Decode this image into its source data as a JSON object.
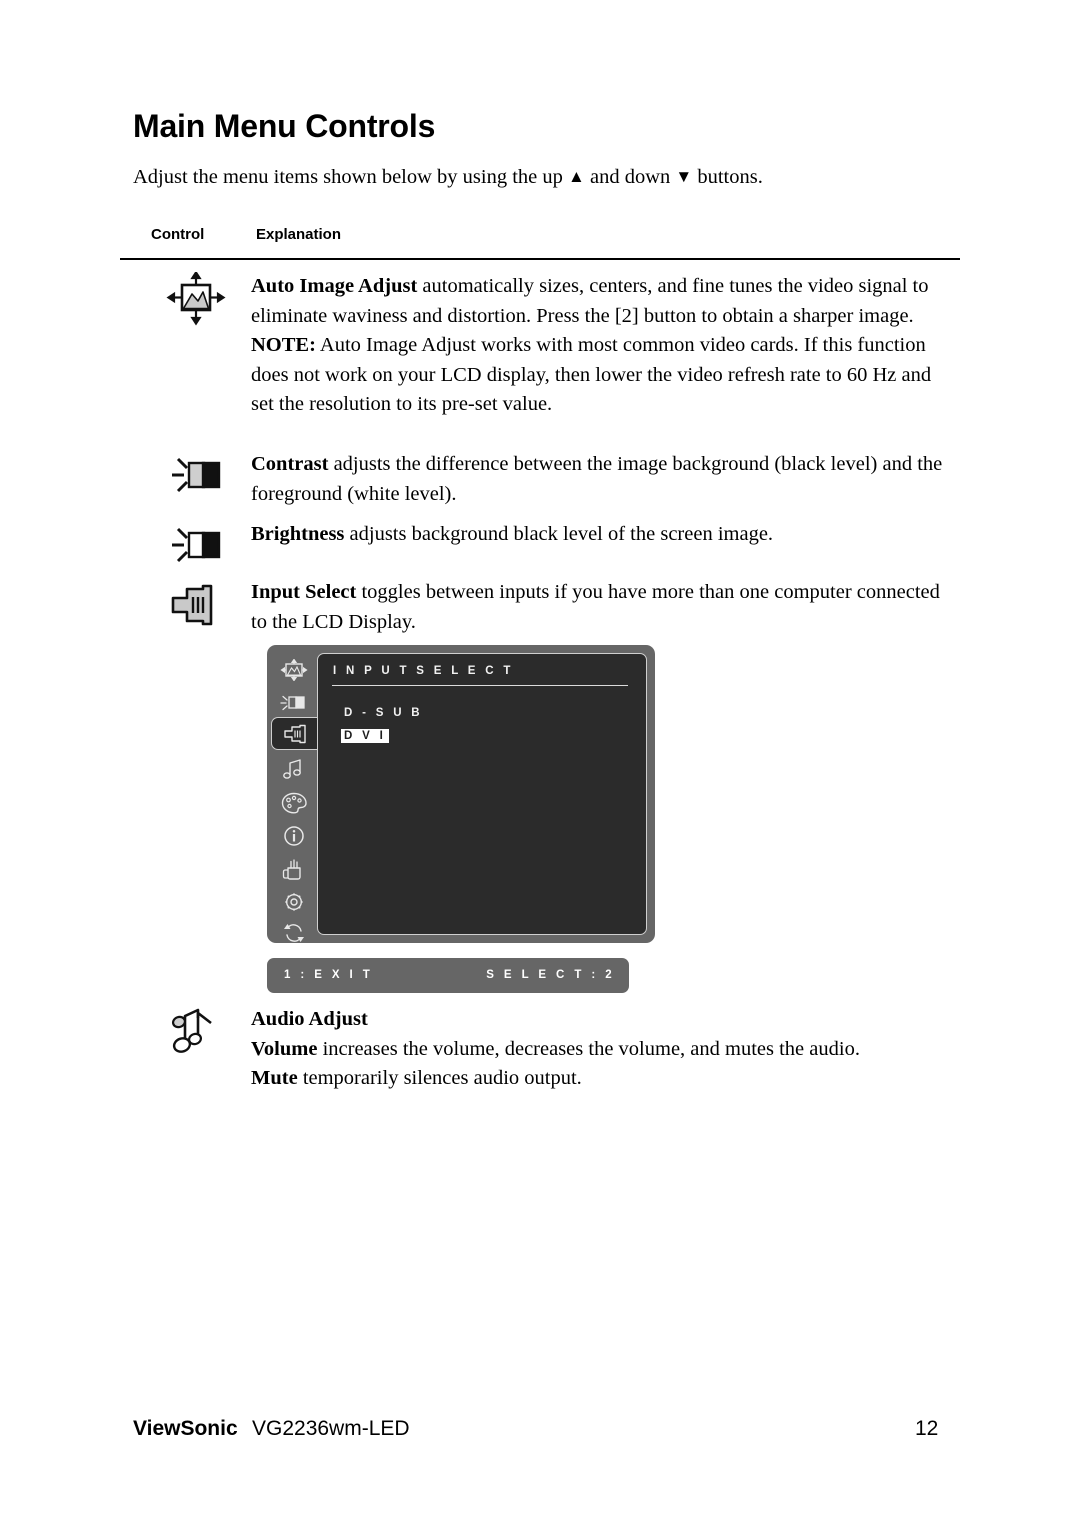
{
  "document": {
    "title": "Main Menu Controls",
    "intro_before": "Adjust the menu items shown below by using the up ",
    "intro_up_glyph": "▲",
    "intro_middle": " and down ",
    "intro_down_glyph": "▼",
    "intro_after": " buttons."
  },
  "table": {
    "header_control": "Control",
    "header_explanation": "Explanation",
    "rows": [
      {
        "icon": "auto-image-adjust-icon",
        "term": "Auto Image Adjust",
        "body": " automatically sizes, centers, and fine tunes the video signal to eliminate waviness and distortion. Press the [2] button to obtain a sharper image.",
        "note_term": "NOTE:",
        "note_body": " Auto Image Adjust works with most common video cards. If this function does not work on your LCD display, then lower the video refresh rate to 60 Hz and set the resolution to its pre-set value."
      },
      {
        "icon": "contrast-icon",
        "term": "Contrast",
        "body": " adjusts the difference between the image background (black level) and the foreground (white level)."
      },
      {
        "icon": "brightness-icon",
        "term": "Brightness",
        "body": " adjusts background black level of the screen image."
      },
      {
        "icon": "input-select-icon",
        "term": "Input Select",
        "body": " toggles between inputs if you have more than one computer connected to the LCD Display."
      },
      {
        "icon": "audio-note-icon",
        "heading": "Audio Adjust",
        "term": "Volume",
        "body": " increases the volume, decreases the volume, and mutes the audio.",
        "term2": "Mute",
        "body2": " temporarily silences audio output."
      }
    ]
  },
  "osd": {
    "title": "I N P U T   S E L E C T",
    "options": [
      {
        "label": "D - S U B",
        "selected": false
      },
      {
        "label": "D V I",
        "selected": true
      }
    ],
    "footer_left": "1 : E X I T",
    "footer_right": "S E L E C T : 2",
    "sidebar_icons": [
      "auto-image-adjust-icon",
      "brightness-contrast-icon",
      "input-select-icon",
      "audio-adjust-icon",
      "color-adjust-icon",
      "information-icon",
      "manual-image-adjust-icon",
      "setup-menu-icon",
      "memory-recall-icon"
    ],
    "active_sidebar_index": 2,
    "colors": {
      "panel": "#666666",
      "screen": "#2b2b2b",
      "text": "#f2f2f2",
      "selection_bg": "#ffffff",
      "selection_fg": "#1d1d1d"
    }
  },
  "footer": {
    "brand": "ViewSonic",
    "model": "VG2236wm-LED",
    "page_number": "12"
  }
}
